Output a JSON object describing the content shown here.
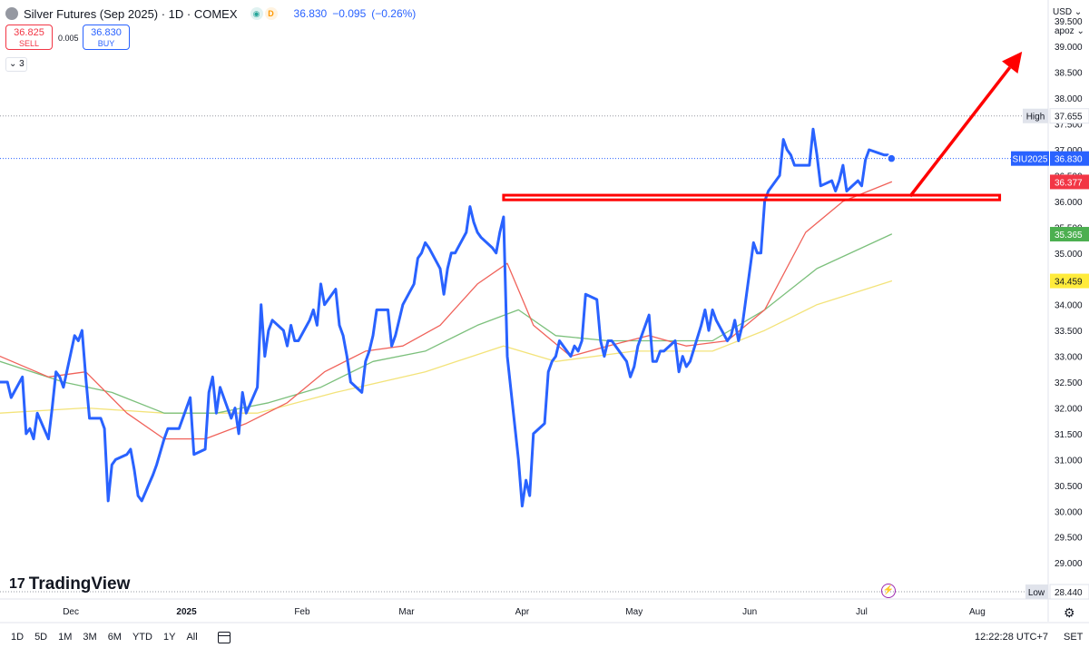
{
  "header": {
    "title": "Silver Futures (Sep 2025) · 1D · COMEX",
    "last": "36.830",
    "change": "−0.095",
    "change_pct": "(−0.26%)",
    "badge_d": "D"
  },
  "trade": {
    "sell_price": "36.825",
    "sell_label": "SELL",
    "buy_price": "36.830",
    "buy_label": "BUY",
    "spread": "0.005"
  },
  "indicators_collapsed": "3",
  "currency": "USD ⌄",
  "scale_mode": "apoz ⌄",
  "brand": "TradingView",
  "brand_mark": "17",
  "timeframes": [
    "1D",
    "5D",
    "1M",
    "3M",
    "6M",
    "YTD",
    "1Y",
    "All"
  ],
  "clock": "12:22:28 UTC+7",
  "session": "SET",
  "colors": {
    "price": "#2962ff",
    "ma_red": "#f0625a",
    "ma_green": "#7cc07c",
    "ma_yellow": "#f3e37a",
    "annotation": "#ff0000"
  },
  "chart_data": {
    "type": "line",
    "symbol": "SIU2025",
    "y_tick_labels": [
      "29.000",
      "29.500",
      "30.000",
      "30.500",
      "31.000",
      "31.500",
      "32.000",
      "32.500",
      "33.000",
      "33.500",
      "34.000",
      "34.500",
      "35.000",
      "35.500",
      "36.000",
      "36.500",
      "37.000",
      "37.500",
      "38.000",
      "38.500",
      "39.000",
      "39.500"
    ],
    "ylim": [
      28.3,
      39.9
    ],
    "x_tick_labels": [
      "Dec",
      "2025",
      "Feb",
      "Mar",
      "Apr",
      "May",
      "Jun",
      "Jul",
      "Aug"
    ],
    "x_tick_dates": [
      "2024-12-01",
      "2025-01-01",
      "2025-02-01",
      "2025-03-01",
      "2025-04-01",
      "2025-05-01",
      "2025-06-01",
      "2025-07-01",
      "2025-08-01"
    ],
    "xlim": [
      "2024-11-12",
      "2025-08-20"
    ],
    "high": {
      "label": "High",
      "value": 37.655
    },
    "low": {
      "label": "Low",
      "value": 28.44
    },
    "price_labels": [
      {
        "text": "SIU2025",
        "value": 36.83,
        "color": "#2962ff"
      },
      {
        "text": "36.377",
        "value": 36.377,
        "color": "#f23645"
      },
      {
        "text": "35.365",
        "value": 35.365,
        "color": "#4caf50"
      },
      {
        "text": "34.459",
        "value": 34.459,
        "color": "#ffeb3b"
      }
    ],
    "series": [
      {
        "name": "Silver Futures (Sep 2025)",
        "color": "#2962ff",
        "values": [
          [
            "2024-11-12",
            32.5
          ],
          [
            "2024-11-14",
            32.5
          ],
          [
            "2024-11-15",
            32.2
          ],
          [
            "2024-11-18",
            32.6
          ],
          [
            "2024-11-19",
            31.5
          ],
          [
            "2024-11-20",
            31.6
          ],
          [
            "2024-11-21",
            31.4
          ],
          [
            "2024-11-22",
            31.9
          ],
          [
            "2024-11-25",
            31.4
          ],
          [
            "2024-11-26",
            32.0
          ],
          [
            "2024-11-27",
            32.7
          ],
          [
            "2024-11-28",
            32.6
          ],
          [
            "2024-11-29",
            32.4
          ],
          [
            "2024-12-02",
            33.4
          ],
          [
            "2024-12-03",
            33.3
          ],
          [
            "2024-12-04",
            33.5
          ],
          [
            "2024-12-05",
            32.6
          ],
          [
            "2024-12-06",
            31.8
          ],
          [
            "2024-12-09",
            31.8
          ],
          [
            "2024-12-10",
            31.6
          ],
          [
            "2024-12-11",
            30.2
          ],
          [
            "2024-12-12",
            30.9
          ],
          [
            "2024-12-13",
            31.0
          ],
          [
            "2024-12-16",
            31.1
          ],
          [
            "2024-12-17",
            31.2
          ],
          [
            "2024-12-18",
            30.8
          ],
          [
            "2024-12-19",
            30.3
          ],
          [
            "2024-12-20",
            30.2
          ],
          [
            "2024-12-23",
            30.7
          ],
          [
            "2024-12-24",
            30.9
          ],
          [
            "2024-12-26",
            31.4
          ],
          [
            "2024-12-27",
            31.6
          ],
          [
            "2024-12-30",
            31.6
          ],
          [
            "2024-12-31",
            31.8
          ],
          [
            "2025-01-02",
            32.2
          ],
          [
            "2025-01-03",
            31.1
          ],
          [
            "2025-01-06",
            31.2
          ],
          [
            "2025-01-07",
            32.3
          ],
          [
            "2025-01-08",
            32.6
          ],
          [
            "2025-01-09",
            31.9
          ],
          [
            "2025-01-10",
            32.4
          ],
          [
            "2025-01-13",
            31.8
          ],
          [
            "2025-01-14",
            32.0
          ],
          [
            "2025-01-15",
            31.5
          ],
          [
            "2025-01-16",
            32.3
          ],
          [
            "2025-01-17",
            31.9
          ],
          [
            "2025-01-20",
            32.4
          ],
          [
            "2025-01-21",
            34.0
          ],
          [
            "2025-01-22",
            33.0
          ],
          [
            "2025-01-23",
            33.5
          ],
          [
            "2025-01-24",
            33.7
          ],
          [
            "2025-01-27",
            33.5
          ],
          [
            "2025-01-28",
            33.2
          ],
          [
            "2025-01-29",
            33.6
          ],
          [
            "2025-01-30",
            33.3
          ],
          [
            "2025-01-31",
            33.3
          ],
          [
            "2025-02-03",
            33.7
          ],
          [
            "2025-02-04",
            33.9
          ],
          [
            "2025-02-05",
            33.6
          ],
          [
            "2025-02-06",
            34.4
          ],
          [
            "2025-02-07",
            34.0
          ],
          [
            "2025-02-10",
            34.3
          ],
          [
            "2025-02-11",
            33.6
          ],
          [
            "2025-02-12",
            33.4
          ],
          [
            "2025-02-13",
            33.0
          ],
          [
            "2025-02-14",
            32.5
          ],
          [
            "2025-02-17",
            32.3
          ],
          [
            "2025-02-18",
            32.9
          ],
          [
            "2025-02-19",
            33.1
          ],
          [
            "2025-02-20",
            33.4
          ],
          [
            "2025-02-21",
            33.9
          ],
          [
            "2025-02-24",
            33.9
          ],
          [
            "2025-02-25",
            33.2
          ],
          [
            "2025-02-26",
            33.4
          ],
          [
            "2025-02-27",
            33.7
          ],
          [
            "2025-02-28",
            34.0
          ],
          [
            "2025-03-03",
            34.4
          ],
          [
            "2025-03-04",
            34.9
          ],
          [
            "2025-03-05",
            35.0
          ],
          [
            "2025-03-06",
            35.2
          ],
          [
            "2025-03-07",
            35.1
          ],
          [
            "2025-03-10",
            34.7
          ],
          [
            "2025-03-11",
            34.2
          ],
          [
            "2025-03-12",
            34.7
          ],
          [
            "2025-03-13",
            35.0
          ],
          [
            "2025-03-14",
            35.0
          ],
          [
            "2025-03-17",
            35.4
          ],
          [
            "2025-03-18",
            35.9
          ],
          [
            "2025-03-19",
            35.6
          ],
          [
            "2025-03-20",
            35.4
          ],
          [
            "2025-03-21",
            35.3
          ],
          [
            "2025-03-24",
            35.1
          ],
          [
            "2025-03-25",
            35.0
          ],
          [
            "2025-03-26",
            35.4
          ],
          [
            "2025-03-27",
            35.7
          ],
          [
            "2025-03-28",
            33.0
          ],
          [
            "2025-03-31",
            31.0
          ],
          [
            "2025-04-01",
            30.1
          ],
          [
            "2025-04-02",
            30.6
          ],
          [
            "2025-04-03",
            30.3
          ],
          [
            "2025-04-04",
            31.5
          ],
          [
            "2025-04-07",
            31.7
          ],
          [
            "2025-04-08",
            32.7
          ],
          [
            "2025-04-09",
            32.9
          ],
          [
            "2025-04-10",
            33.0
          ],
          [
            "2025-04-11",
            33.3
          ],
          [
            "2025-04-14",
            33.0
          ],
          [
            "2025-04-15",
            33.2
          ],
          [
            "2025-04-16",
            33.1
          ],
          [
            "2025-04-17",
            33.3
          ],
          [
            "2025-04-18",
            34.2
          ],
          [
            "2025-04-21",
            34.1
          ],
          [
            "2025-04-22",
            33.3
          ],
          [
            "2025-04-23",
            33.0
          ],
          [
            "2025-04-24",
            33.3
          ],
          [
            "2025-04-25",
            33.3
          ],
          [
            "2025-04-28",
            33.0
          ],
          [
            "2025-04-29",
            32.9
          ],
          [
            "2025-04-30",
            32.6
          ],
          [
            "2025-05-01",
            32.8
          ],
          [
            "2025-05-02",
            33.2
          ],
          [
            "2025-05-05",
            33.8
          ],
          [
            "2025-05-06",
            32.9
          ],
          [
            "2025-05-07",
            32.9
          ],
          [
            "2025-05-08",
            33.1
          ],
          [
            "2025-05-09",
            33.1
          ],
          [
            "2025-05-12",
            33.3
          ],
          [
            "2025-05-13",
            32.7
          ],
          [
            "2025-05-14",
            33.0
          ],
          [
            "2025-05-15",
            32.8
          ],
          [
            "2025-05-16",
            32.9
          ],
          [
            "2025-05-19",
            33.6
          ],
          [
            "2025-05-20",
            33.9
          ],
          [
            "2025-05-21",
            33.5
          ],
          [
            "2025-05-22",
            33.9
          ],
          [
            "2025-05-23",
            33.7
          ],
          [
            "2025-05-26",
            33.3
          ],
          [
            "2025-05-27",
            33.4
          ],
          [
            "2025-05-28",
            33.7
          ],
          [
            "2025-05-29",
            33.3
          ],
          [
            "2025-05-30",
            33.6
          ],
          [
            "2025-06-02",
            35.2
          ],
          [
            "2025-06-03",
            35.0
          ],
          [
            "2025-06-04",
            35.0
          ],
          [
            "2025-06-05",
            36.0
          ],
          [
            "2025-06-06",
            36.2
          ],
          [
            "2025-06-09",
            36.5
          ],
          [
            "2025-06-10",
            37.2
          ],
          [
            "2025-06-11",
            37.0
          ],
          [
            "2025-06-12",
            36.9
          ],
          [
            "2025-06-13",
            36.7
          ],
          [
            "2025-06-16",
            36.7
          ],
          [
            "2025-06-17",
            36.7
          ],
          [
            "2025-06-18",
            37.4
          ],
          [
            "2025-06-19",
            36.9
          ],
          [
            "2025-06-20",
            36.3
          ],
          [
            "2025-06-23",
            36.4
          ],
          [
            "2025-06-24",
            36.2
          ],
          [
            "2025-06-25",
            36.4
          ],
          [
            "2025-06-26",
            36.7
          ],
          [
            "2025-06-27",
            36.2
          ],
          [
            "2025-06-30",
            36.4
          ],
          [
            "2025-07-01",
            36.3
          ],
          [
            "2025-07-02",
            36.8
          ],
          [
            "2025-07-03",
            37.0
          ],
          [
            "2025-07-07",
            36.9
          ],
          [
            "2025-07-08",
            36.9
          ],
          [
            "2025-07-09",
            36.83
          ]
        ]
      },
      {
        "name": "MA fast",
        "color": "#f0625a",
        "values": [
          [
            "2024-11-12",
            33.0
          ],
          [
            "2024-11-25",
            32.6
          ],
          [
            "2024-12-05",
            32.7
          ],
          [
            "2024-12-16",
            31.9
          ],
          [
            "2024-12-26",
            31.4
          ],
          [
            "2025-01-06",
            31.4
          ],
          [
            "2025-01-17",
            31.7
          ],
          [
            "2025-01-28",
            32.1
          ],
          [
            "2025-02-07",
            32.7
          ],
          [
            "2025-02-18",
            33.1
          ],
          [
            "2025-02-28",
            33.2
          ],
          [
            "2025-03-10",
            33.6
          ],
          [
            "2025-03-20",
            34.4
          ],
          [
            "2025-03-28",
            34.8
          ],
          [
            "2025-04-04",
            33.6
          ],
          [
            "2025-04-14",
            33.0
          ],
          [
            "2025-04-24",
            33.2
          ],
          [
            "2025-05-05",
            33.4
          ],
          [
            "2025-05-15",
            33.2
          ],
          [
            "2025-05-26",
            33.3
          ],
          [
            "2025-06-05",
            33.9
          ],
          [
            "2025-06-16",
            35.4
          ],
          [
            "2025-06-26",
            36.0
          ],
          [
            "2025-07-09",
            36.377
          ]
        ]
      },
      {
        "name": "MA medium",
        "color": "#7cc07c",
        "values": [
          [
            "2024-11-12",
            32.9
          ],
          [
            "2024-11-29",
            32.5
          ],
          [
            "2024-12-12",
            32.3
          ],
          [
            "2024-12-26",
            31.9
          ],
          [
            "2025-01-09",
            31.9
          ],
          [
            "2025-01-23",
            32.1
          ],
          [
            "2025-02-06",
            32.4
          ],
          [
            "2025-02-20",
            32.9
          ],
          [
            "2025-03-06",
            33.1
          ],
          [
            "2025-03-20",
            33.6
          ],
          [
            "2025-03-31",
            33.9
          ],
          [
            "2025-04-10",
            33.4
          ],
          [
            "2025-04-24",
            33.3
          ],
          [
            "2025-05-08",
            33.3
          ],
          [
            "2025-05-22",
            33.3
          ],
          [
            "2025-06-05",
            33.9
          ],
          [
            "2025-06-19",
            34.7
          ],
          [
            "2025-07-09",
            35.365
          ]
        ]
      },
      {
        "name": "MA slow",
        "color": "#f3e37a",
        "values": [
          [
            "2024-11-12",
            31.9
          ],
          [
            "2024-12-05",
            32.0
          ],
          [
            "2024-12-26",
            31.9
          ],
          [
            "2025-01-20",
            31.9
          ],
          [
            "2025-02-10",
            32.3
          ],
          [
            "2025-03-06",
            32.7
          ],
          [
            "2025-03-27",
            33.2
          ],
          [
            "2025-04-10",
            32.9
          ],
          [
            "2025-05-01",
            33.1
          ],
          [
            "2025-05-22",
            33.1
          ],
          [
            "2025-06-05",
            33.5
          ],
          [
            "2025-06-19",
            34.0
          ],
          [
            "2025-07-09",
            34.459
          ]
        ]
      }
    ],
    "annotations": [
      {
        "type": "rect",
        "x0": "2025-03-27",
        "x1": "2025-08-07",
        "y0": 36.12,
        "y1": 36.03,
        "color": "#ff0000"
      },
      {
        "type": "arrow",
        "x0": "2025-07-14",
        "y0": 36.1,
        "x1": "2025-08-13",
        "y1": 38.9,
        "color": "#ff0000"
      }
    ]
  }
}
